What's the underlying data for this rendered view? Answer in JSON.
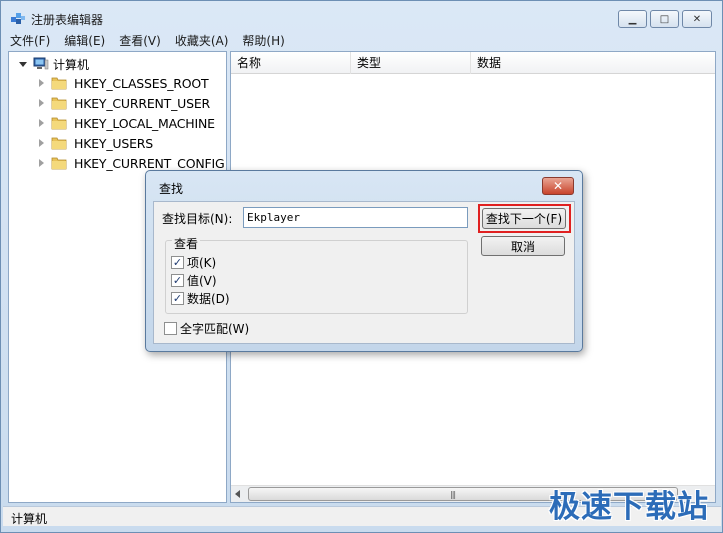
{
  "window": {
    "title": "注册表编辑器",
    "controls": {
      "minimize": "▁",
      "maximize": "□",
      "close": "✕"
    }
  },
  "menu": [
    "文件(F)",
    "编辑(E)",
    "查看(V)",
    "收藏夹(A)",
    "帮助(H)"
  ],
  "tree": {
    "root": "计算机",
    "nodes": [
      "HKEY_CLASSES_ROOT",
      "HKEY_CURRENT_USER",
      "HKEY_LOCAL_MACHINE",
      "HKEY_USERS",
      "HKEY_CURRENT_CONFIG"
    ]
  },
  "list": {
    "columns": [
      "名称",
      "类型",
      "数据"
    ],
    "scroll_grip": "|||"
  },
  "status": {
    "text": "计算机"
  },
  "watermark": "极速下载站",
  "find_dialog": {
    "title": "查找",
    "close": "✕",
    "target_label": "查找目标(N):",
    "target_value": "Ekplayer",
    "find_next": "查找下一个(F)",
    "cancel": "取消",
    "look_at_label": "查看",
    "options": [
      {
        "label": "项(K)",
        "checked": true
      },
      {
        "label": "值(V)",
        "checked": true
      },
      {
        "label": "数据(D)",
        "checked": true
      }
    ],
    "whole_string": {
      "label": "全字匹配(W)",
      "checked": false
    }
  },
  "colors": {
    "accent": "#2c6cb8",
    "highlight": "#e02020"
  }
}
